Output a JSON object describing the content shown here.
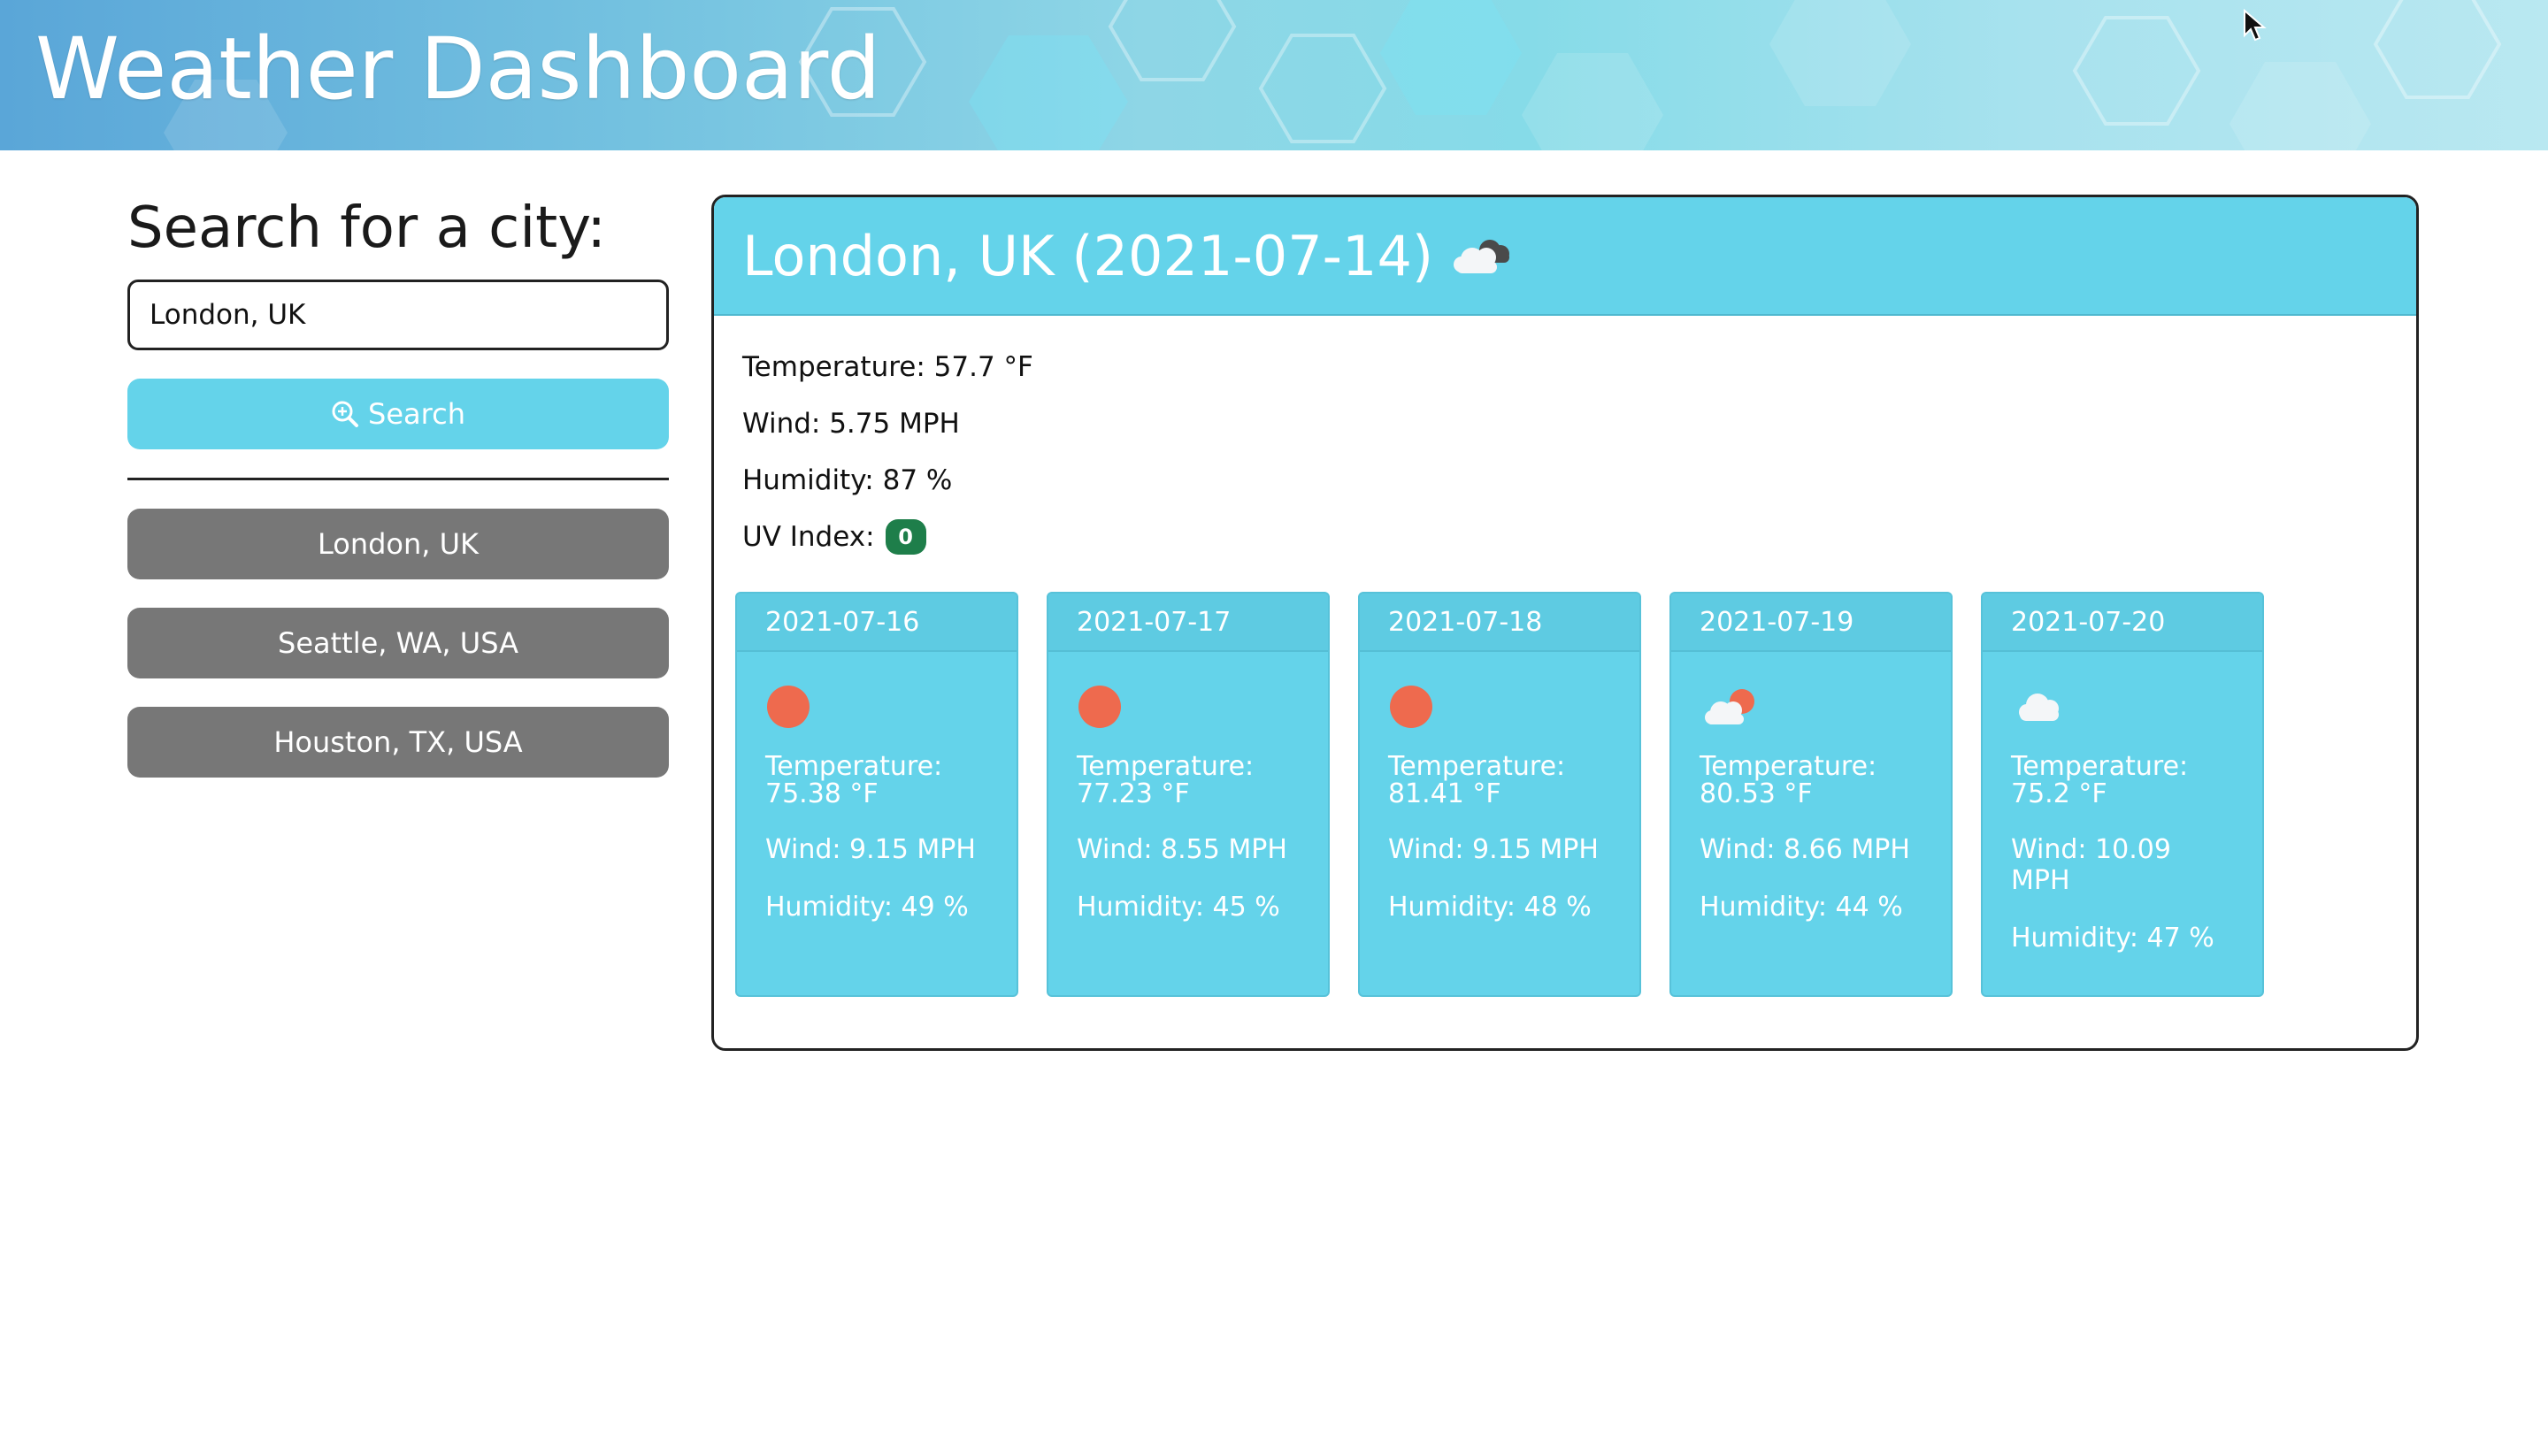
{
  "header": {
    "title": "Weather Dashboard",
    "cursor_icon": "mouse-pointer-icon"
  },
  "sidebar": {
    "label": "Search for a city:",
    "search_value": "London, UK",
    "search_button_label": "Search",
    "search_icon": "magnifier-zoom-icon",
    "history": [
      {
        "label": "London, UK"
      },
      {
        "label": "Seattle, WA, USA"
      },
      {
        "label": "Houston, TX, USA"
      }
    ]
  },
  "current": {
    "title": "London, UK (2021-07-14)",
    "icon": "cloudy-icon",
    "temperature": "Temperature: 57.7 °F",
    "wind": "Wind: 5.75 MPH",
    "humidity": "Humidity: 87 %",
    "uv_label": "UV Index:",
    "uv_value": "0"
  },
  "forecast": [
    {
      "date": "2021-07-16",
      "icon": "sun-icon",
      "temp_label": "Temperature:",
      "temp": "75.38 °F",
      "wind": "Wind: 9.15 MPH",
      "humidity": "Humidity: 49 %"
    },
    {
      "date": "2021-07-17",
      "icon": "sun-icon",
      "temp_label": "Temperature:",
      "temp": "77.23 °F",
      "wind": "Wind: 8.55 MPH",
      "humidity": "Humidity: 45 %"
    },
    {
      "date": "2021-07-18",
      "icon": "sun-icon",
      "temp_label": "Temperature:",
      "temp": "81.41 °F",
      "wind": "Wind: 9.15 MPH",
      "humidity": "Humidity: 48 %"
    },
    {
      "date": "2021-07-19",
      "icon": "partly-cloudy-icon",
      "temp_label": "Temperature:",
      "temp": "80.53 °F",
      "wind": "Wind: 8.66 MPH",
      "humidity": "Humidity: 44 %"
    },
    {
      "date": "2021-07-20",
      "icon": "cloud-icon",
      "temp_label": "Temperature:",
      "temp": "75.2 °F",
      "wind": "Wind: 10.09 MPH",
      "humidity": "Humidity: 47 %"
    }
  ],
  "colors": {
    "accent": "#64d3ea",
    "history_button": "#777777",
    "uv_badge": "#1e7e4a",
    "sun": "#ee6a4e"
  }
}
